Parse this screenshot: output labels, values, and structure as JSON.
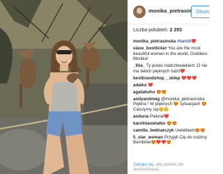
{
  "post": {
    "username": "monika_pietrasinska",
    "follow_label": "Obserwuj",
    "likes_label": "Liczba polubień:",
    "likes_count": "2 293"
  },
  "comments": [
    {
      "user": "monika_pietrasinska",
      "text": "#bambi",
      "emoji": "❤️"
    },
    {
      "user": "slave_bootlicker",
      "text": "You are the most beautiful woman in the world, Goddess Monika!",
      "emoji": ""
    },
    {
      "user": "_lliia_",
      "text": "Ty jestes nadczłowiekiem :D nie ma takich pięknych ludzi",
      "emoji": "❤️"
    },
    {
      "user": "bestbrandshop__sklep",
      "text": "",
      "emoji": "❤️❤️❤️"
    },
    {
      "user": "adaiko",
      "text": "",
      "emoji": "❤️"
    },
    {
      "user": "agatabuhu",
      "text": "",
      "emoji": "😍😍"
    },
    {
      "user": "andyandmeg",
      "text": "@monika_pietrasinska Piękna ! W pięknych 😍 sytuacjach 😍 Cieszymy się",
      "emoji": "😊😊"
    },
    {
      "user": "anituria",
      "text": "Pieknie",
      "emoji": "❤️"
    },
    {
      "user": "karolinaswiatko",
      "text": "",
      "emoji": "😍😍"
    },
    {
      "user": "camilla_bednarczyk",
      "text": "Uwielbiam",
      "emoji": "😍😍"
    },
    {
      "user": "5_star_woman",
      "text": "Przyjęli Cię do rodziny Bambiów",
      "emoji": "😍❤️❤️😍"
    }
  ],
  "footer": {
    "login_link": "Zaloguj się",
    "rest": ", aby polubić lub skomentować."
  },
  "colors": {
    "accent": "#3897f0",
    "text": "#262626",
    "muted": "#999999"
  }
}
